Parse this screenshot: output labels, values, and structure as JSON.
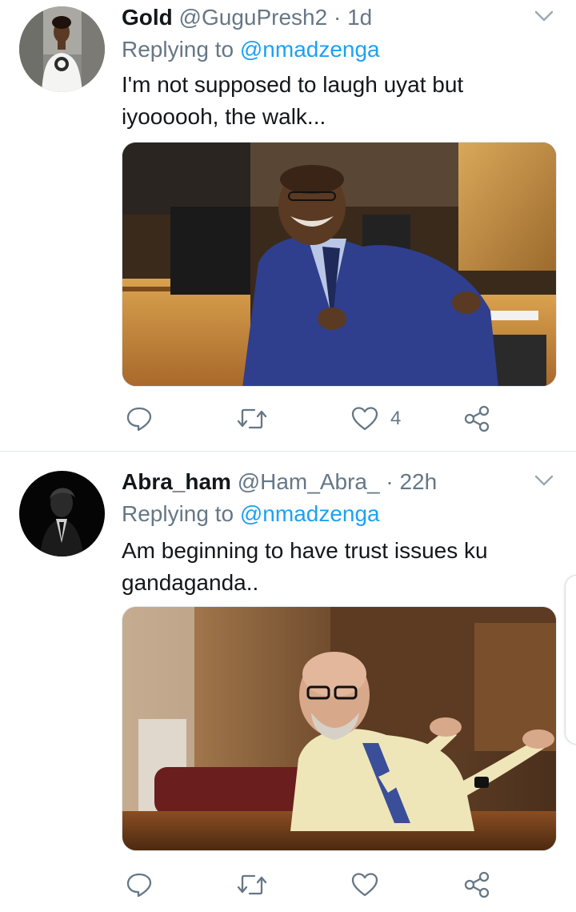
{
  "colors": {
    "primary_text": "#14171a",
    "secondary_text": "#657786",
    "link_blue": "#1da1f2",
    "divider": "#e1e8ed",
    "icon_gray": "#657786"
  },
  "tweets": [
    {
      "display_name": "Gold",
      "handle": "@GuguPresh2",
      "separator": "·",
      "time": "1d",
      "replying_label": "Replying to",
      "replying_to": "@nmadzenga",
      "text_line1": "I'm not supposed to laugh uyat but",
      "text_line2": "iyoooooh, the walk...",
      "media_alt": "photo",
      "actions": {
        "reply_icon": "reply-icon",
        "retweet_icon": "retweet-icon",
        "like_icon": "heart-icon",
        "like_count": "4",
        "share_icon": "share-icon"
      }
    },
    {
      "display_name": "Abra_ham",
      "handle": "@Ham_Abra_",
      "separator": "·",
      "time": "22h",
      "replying_label": "Replying to",
      "replying_to": "@nmadzenga",
      "text_line1": "Am beginning to have trust issues ku",
      "text_line2": "gandaganda..",
      "media_alt": "photo",
      "actions": {
        "reply_icon": "reply-icon",
        "retweet_icon": "retweet-icon",
        "like_icon": "heart-icon",
        "like_count": "",
        "share_icon": "share-icon"
      }
    }
  ]
}
